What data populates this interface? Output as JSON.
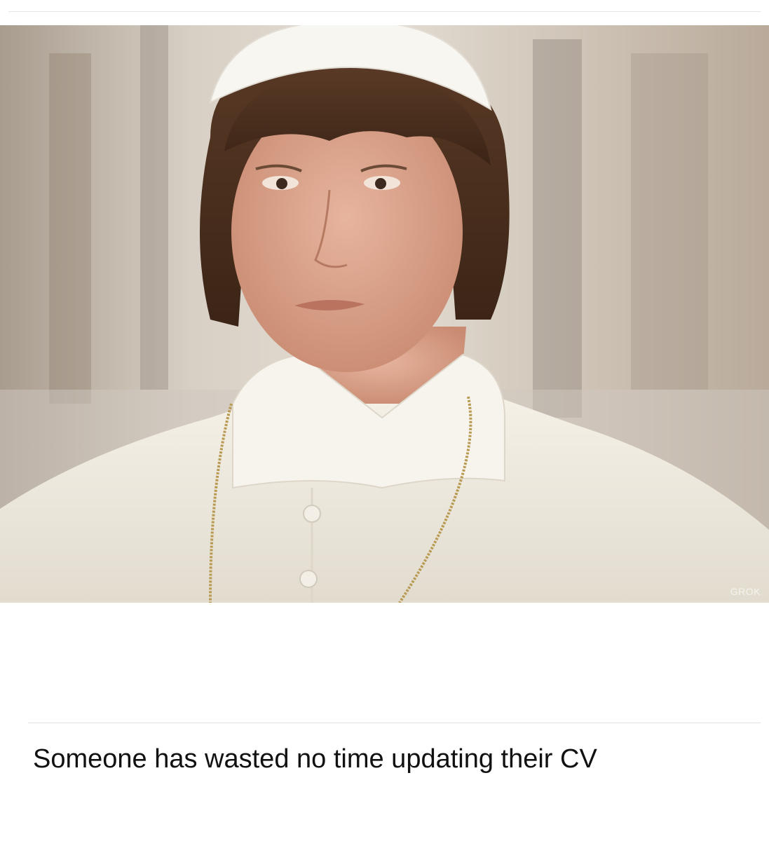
{
  "post": {
    "image": {
      "subject": "portrait-photo",
      "watermark_text": "GROK"
    },
    "caption": "Someone has wasted no time updating their CV"
  }
}
